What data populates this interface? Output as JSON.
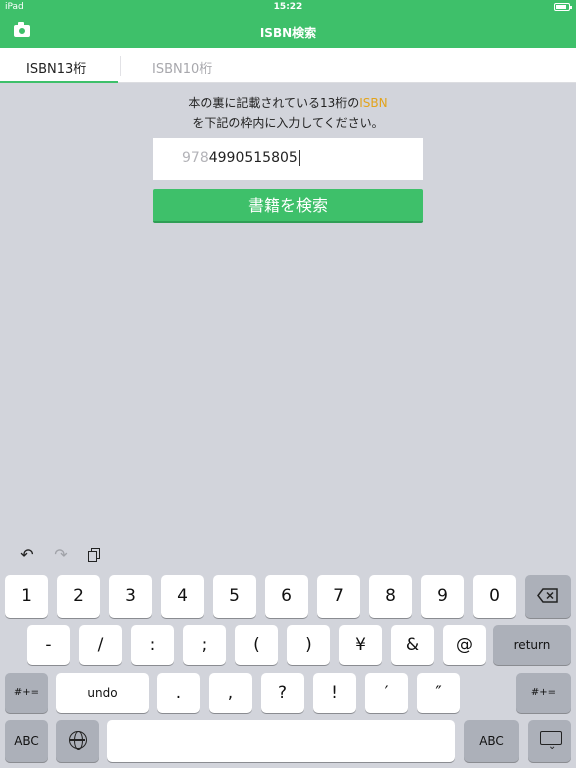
{
  "status_bar": {
    "carrier": "iPad",
    "time": "15:22"
  },
  "nav": {
    "title": "ISBN検索",
    "camera_icon": "camera-icon"
  },
  "tabs": [
    {
      "label": "ISBN13桁",
      "active": true
    },
    {
      "label": "ISBN10桁",
      "active": false
    }
  ],
  "instructions": {
    "line1_before": "本の裏に記載されている13桁の",
    "line1_highlight": "ISBN",
    "line2": "を下記の枠内に入力してください。"
  },
  "isbn_field": {
    "prefix": "978",
    "value": "4990515805"
  },
  "search_button": {
    "label": "書籍を検索"
  },
  "colors": {
    "accent": "#3ec06a",
    "highlight": "#e3a31a",
    "keyboard_bg": "#d2d4db"
  },
  "keyboard": {
    "toolbar": {
      "undo_icon": "↶",
      "redo_icon": "↷"
    },
    "row1": [
      "1",
      "2",
      "3",
      "4",
      "5",
      "6",
      "7",
      "8",
      "9",
      "0"
    ],
    "row2": [
      "-",
      "/",
      ":",
      ";",
      "(",
      ")",
      "¥",
      "&",
      "@"
    ],
    "return_label": "return",
    "row3_left": "#+=",
    "undo_label": "undo",
    "row3": [
      ".",
      ",",
      "?",
      "!",
      "′",
      "″"
    ],
    "row3_right": "#+=",
    "abc_left": "ABC",
    "abc_right": "ABC"
  }
}
